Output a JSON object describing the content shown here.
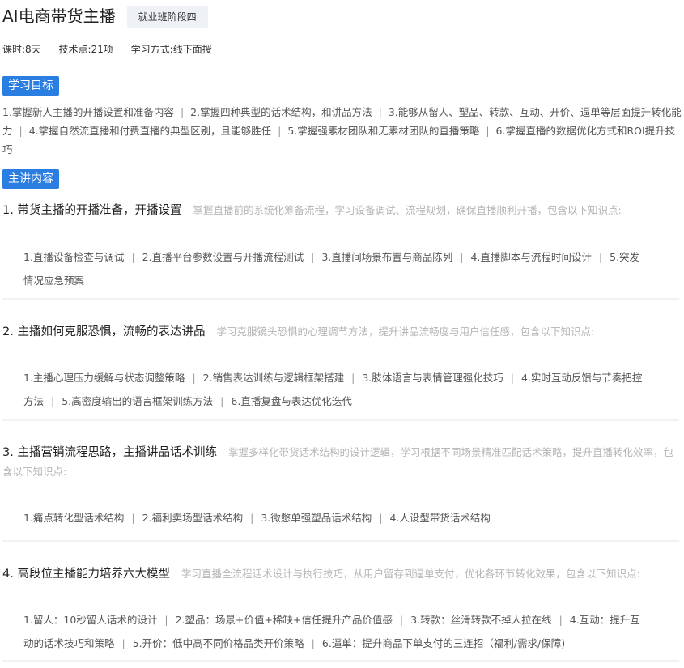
{
  "header": {
    "title": "AI电商带货主播",
    "badge": "就业班阶段四"
  },
  "meta": {
    "duration": "课时:8天",
    "tech_points": "技术点:21项",
    "method": "学习方式:线下面授"
  },
  "goals_section": {
    "label": "学习目标",
    "items": [
      "1.掌握新人主播的开播设置和准备内容",
      "2.掌握四种典型的话术结构，和讲品方法",
      "3.能够从留人、塑品、转款、互动、开价、逼单等层面提升转化能力",
      "4.掌握自然流直播和付费直播的典型区别，且能够胜任",
      "5.掌握强素材团队和无素材团队的直播策略",
      "6.掌握直播的数据优化方式和ROI提升技巧"
    ]
  },
  "content_section": {
    "label": "主讲内容",
    "modules": [
      {
        "title": "1. 带货主播的开播准备，开播设置",
        "desc": "掌握直播前的系统化筹备流程，学习设备调试、流程规划，确保直播顺利开播，包含以下知识点:",
        "points": [
          "1.直播设备检查与调试",
          "2.直播平台参数设置与开播流程测试",
          "3.直播间场景布置与商品陈列",
          "4.直播脚本与流程时间设计",
          "5.突发情况应急预案"
        ]
      },
      {
        "title": "2. 主播如何克服恐惧，流畅的表达讲品",
        "desc": "学习克服镜头恐惧的心理调节方法，提升讲品流畅度与用户信任感，包含以下知识点:",
        "points": [
          "1.主播心理压力缓解与状态调整策略",
          "2.销售表达训练与逻辑框架搭建",
          "3.肢体语言与表情管理强化技巧",
          "4.实时互动反馈与节奏把控方法",
          "5.高密度输出的语言框架训练方法",
          "6.直播复盘与表达优化迭代"
        ]
      },
      {
        "title": "3. 主播营销流程思路，主播讲品话术训练",
        "desc": "掌握多样化带货话术结构的设计逻辑，学习根据不同场景精准匹配话术策略，提升直播转化效率，包含以下知识点:",
        "points": [
          "1.痛点转化型话术结构",
          "2.福利卖场型话术结构",
          "3.微憋单强塑品话术结构",
          "4.人设型带货话术结构"
        ]
      },
      {
        "title": "4. 高段位主播能力培养六大模型",
        "desc": "学习直播全流程话术设计与执行技巧，从用户留存到逼单支付，优化各环节转化效果，包含以下知识点:",
        "points": [
          "1.留人：10秒留人话术的设计",
          "2.塑品：场景+价值+稀缺+信任提升产品价值感",
          "3.转款：丝滑转款不掉人拉在线",
          "4.互动：提升互动的话术技巧和策略",
          "5.开价：低中高不同价格品类开价策略",
          "6.逼单：提升商品下单支付的三连招（福利/需求/保障)"
        ]
      }
    ]
  },
  "colors": {
    "accent": "#2a7de1",
    "badge_bg": "#eef1f5",
    "desc_text": "#b5b5b5"
  }
}
